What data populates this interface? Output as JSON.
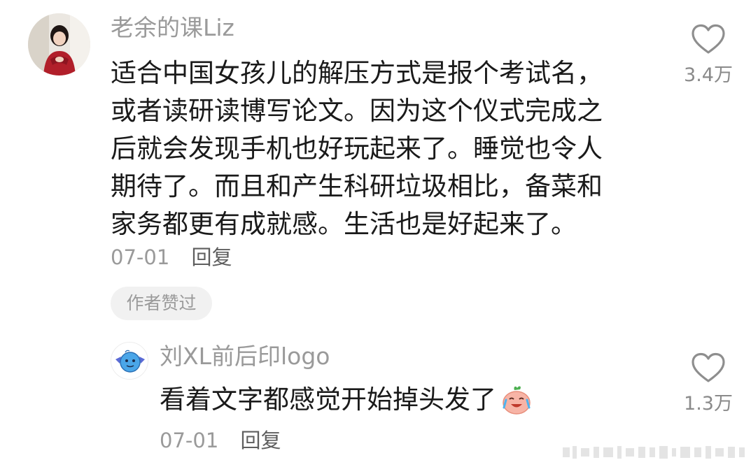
{
  "comments": [
    {
      "username": "老余的课Liz",
      "lines": [
        "适合中国女孩儿的解压方式是报个考试名，",
        "或者读研读博写论文。因为这个仪式完成之",
        "后就会发现手机也好玩起来了。睡觉也令人",
        "期待了。而且和产生科研垃圾相比，备菜和",
        "家务都更有成就感。生活也是好起来了。"
      ],
      "date": "07-01",
      "reply_label": "回复",
      "badge": "作者赞过",
      "like_count": "3.4万"
    },
    {
      "username": "刘XL前后印logo",
      "text": "看着文字都感觉开始掉头发了",
      "emoji": "crying-laughing-peach-emoji",
      "date": "07-01",
      "reply_label": "回复",
      "like_count": "1.3万"
    }
  ],
  "icons": {
    "like": "heart-outline-icon"
  },
  "colors": {
    "text_primary": "#1a1a1a",
    "text_secondary": "#9a9a9a",
    "badge_bg": "#f1f1f1"
  }
}
